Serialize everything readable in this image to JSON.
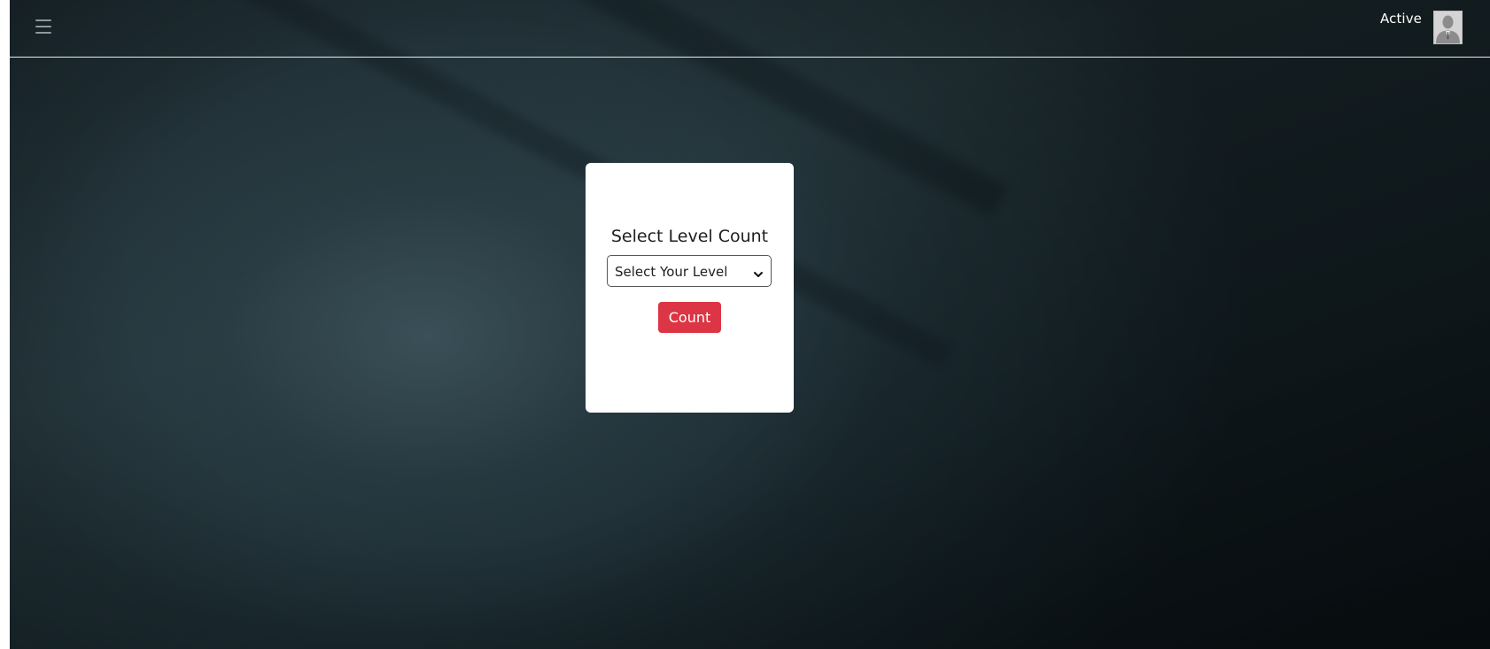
{
  "header": {
    "status_text": "Active",
    "menu_icon": "hamburger-menu-icon",
    "avatar_icon": "user-avatar-icon"
  },
  "card": {
    "title": "Select Level Count",
    "select": {
      "selected_value": "Select Your Level",
      "icon": "chevron-down-icon"
    },
    "button_label": "Count"
  },
  "colors": {
    "accent_button": "#dc3545",
    "background_dark": "#1c2a30",
    "card_background": "#ffffff"
  }
}
